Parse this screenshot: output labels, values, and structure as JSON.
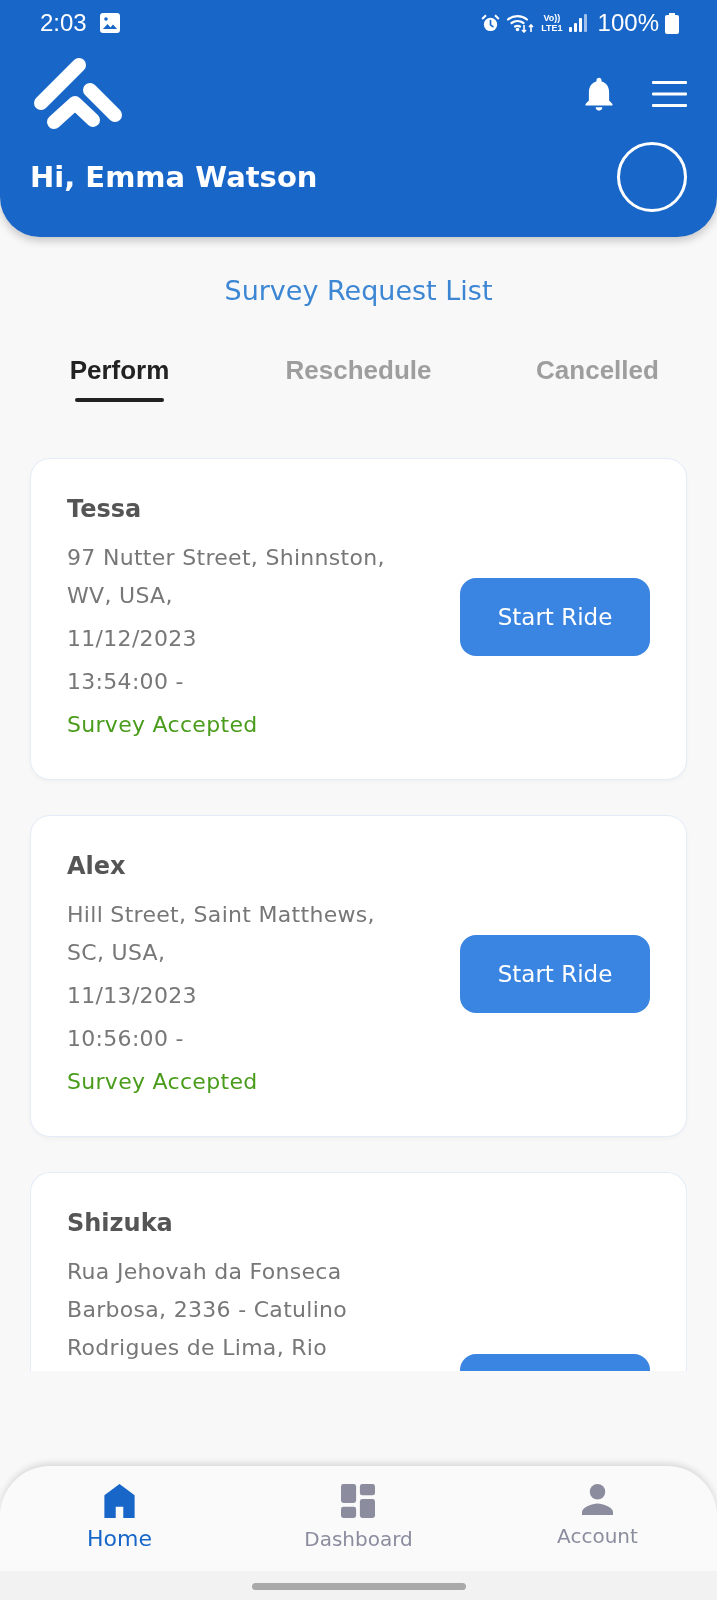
{
  "status_bar": {
    "time": "2:03",
    "volte": "Vo))",
    "network": "LTE1",
    "battery": "100%"
  },
  "header": {
    "greeting": "Hi, Emma Watson"
  },
  "title": "Survey Request List",
  "tabs": [
    {
      "label": "Perform",
      "selected": true
    },
    {
      "label": "Reschedule",
      "selected": false
    },
    {
      "label": "Cancelled",
      "selected": false
    }
  ],
  "requests": [
    {
      "name": "Tessa",
      "address": "97 Nutter Street, Shinnston, WV, USA,",
      "date": "11/12/2023",
      "time": "13:54:00 -",
      "status": "Survey Accepted",
      "action": "Start Ride"
    },
    {
      "name": "Alex",
      "address": "Hill Street, Saint Matthews, SC, USA,",
      "date": "11/13/2023",
      "time": "10:56:00 -",
      "status": "Survey Accepted",
      "action": "Start Ride"
    },
    {
      "name": "Shizuka",
      "address": "Rua Jehovah da Fonseca Barbosa, 2336 - Catulino Rodrigues de Lima, Rio"
    }
  ],
  "bottom_nav": [
    {
      "label": "Home",
      "selected": true
    },
    {
      "label": "Dashboard",
      "selected": false
    },
    {
      "label": "Account",
      "selected": false
    }
  ]
}
